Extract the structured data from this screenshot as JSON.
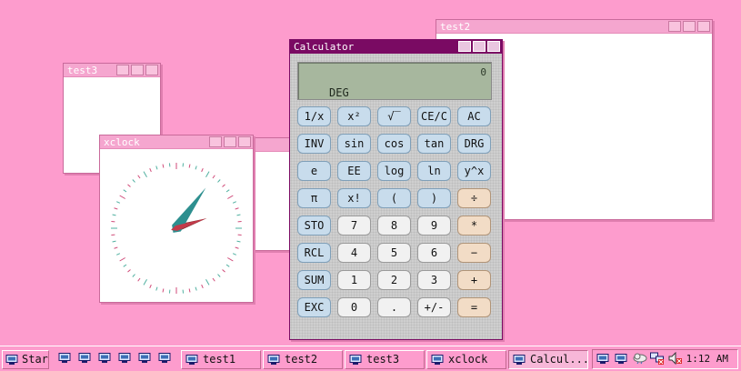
{
  "colors": {
    "desktop": "#fd9ccd",
    "active_title": "#7a0a63",
    "inactive_title": "#f5a6cf"
  },
  "windows": {
    "test2": {
      "title": "test2"
    },
    "test3": {
      "title": "test3"
    },
    "xclock": {
      "title": "xclock"
    },
    "calculator": {
      "title": "Calculator"
    }
  },
  "calculator": {
    "display_value": "0",
    "mode": "DEG",
    "rows": [
      [
        "1/x",
        "x²",
        "√‾",
        "CE/C",
        "AC"
      ],
      [
        "INV",
        "sin",
        "cos",
        "tan",
        "DRG"
      ],
      [
        "e",
        "EE",
        "log",
        "ln",
        "y^x"
      ],
      [
        "π",
        "x!",
        "(",
        ")",
        "÷"
      ],
      [
        "STO",
        "7",
        "8",
        "9",
        "*"
      ],
      [
        "RCL",
        "4",
        "5",
        "6",
        "−"
      ],
      [
        "SUM",
        "1",
        "2",
        "3",
        "+"
      ],
      [
        "EXC",
        "0",
        ".",
        "+/-",
        "="
      ]
    ]
  },
  "clock": {
    "hour": 1,
    "minute": 12
  },
  "taskbar": {
    "start_label": "Start",
    "buttons": [
      "test1",
      "test2",
      "test3",
      "xclock",
      "Calcul..."
    ],
    "time": "1:12 AM"
  }
}
